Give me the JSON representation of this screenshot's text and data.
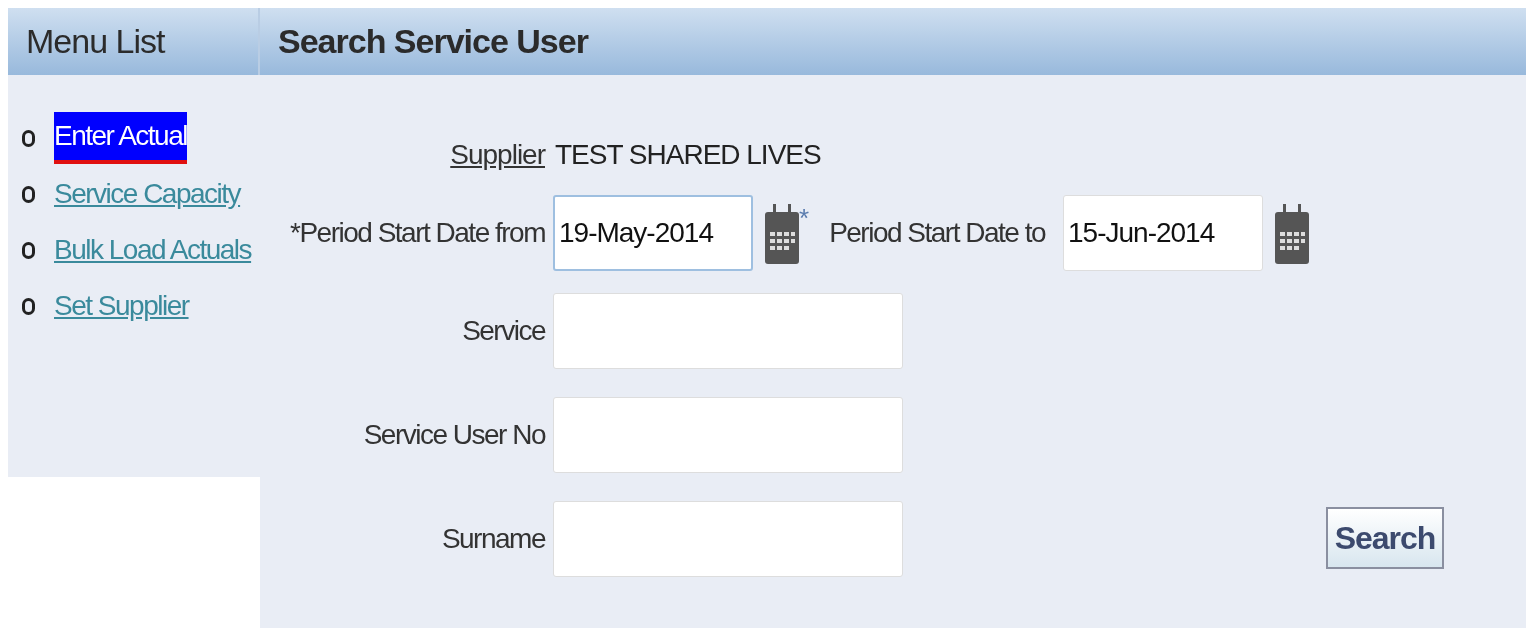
{
  "menu": {
    "title": "Menu List",
    "items": [
      {
        "label": "Enter Actual",
        "selected": true
      },
      {
        "label": "Service Capacity",
        "selected": false
      },
      {
        "label": "Bulk Load Actuals",
        "selected": false
      },
      {
        "label": "Set Supplier",
        "selected": false
      }
    ]
  },
  "main": {
    "title": "Search Service User",
    "supplier": {
      "label": "Supplier",
      "value": "TEST SHARED LIVES"
    },
    "date_row": {
      "from_label": "*Period Start Date from",
      "from_value": "19-May-2014",
      "from_suffix": "*",
      "to_label": "Period Start Date to",
      "to_value": "15-Jun-2014"
    },
    "fields": [
      {
        "label": "Service"
      },
      {
        "label": "Service User No"
      },
      {
        "label": "Surname"
      }
    ],
    "search_button": "Search"
  }
}
